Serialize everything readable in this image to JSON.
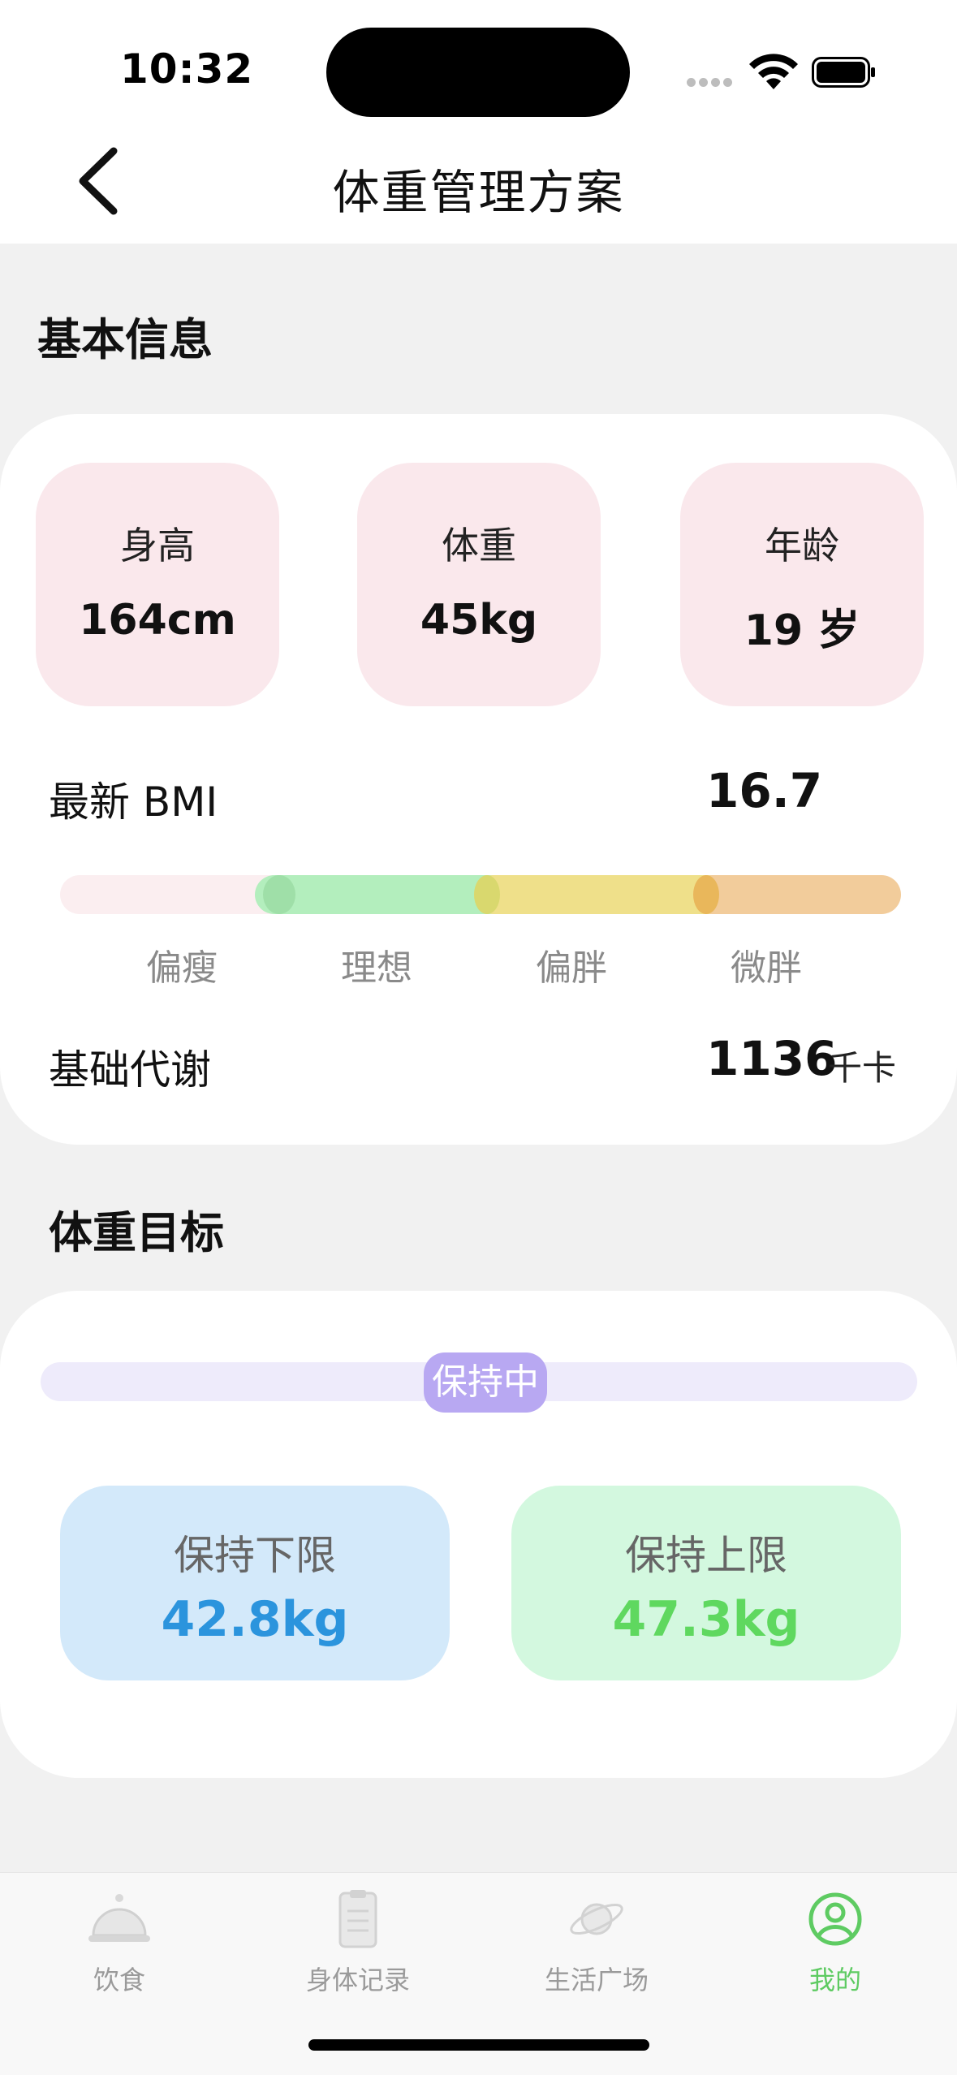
{
  "status_bar": {
    "time": "10:32"
  },
  "header": {
    "title": "体重管理方案",
    "back_icon": "chevron-left-icon"
  },
  "basic_info": {
    "section_title": "基本信息",
    "stats": [
      {
        "label": "身高",
        "value": "164cm"
      },
      {
        "label": "体重",
        "value": "45kg"
      },
      {
        "label": "年龄",
        "value": "19 岁"
      }
    ],
    "bmi": {
      "label": "最新 BMI",
      "value": "16.7",
      "categories": [
        "偏瘦",
        "理想",
        "偏胖",
        "微胖"
      ],
      "colors": [
        "#fbeef0",
        "#b3eebd",
        "#efe08a",
        "#f2cc9b"
      ]
    },
    "bmr": {
      "label": "基础代谢",
      "value": "1136",
      "unit": "千卡"
    }
  },
  "weight_goal": {
    "section_title": "体重目标",
    "status": "保持中",
    "lower": {
      "label": "保持下限",
      "value": "42.8kg",
      "color": "#2b94dd",
      "bg": "#d3e9fa"
    },
    "upper": {
      "label": "保持上限",
      "value": "47.3kg",
      "color": "#5fd85f",
      "bg": "#d3f8df"
    }
  },
  "tab_bar": {
    "items": [
      {
        "label": "饮食",
        "icon": "cloche-icon",
        "active": false
      },
      {
        "label": "身体记录",
        "icon": "clipboard-icon",
        "active": false
      },
      {
        "label": "生活广场",
        "icon": "planet-icon",
        "active": false
      },
      {
        "label": "我的",
        "icon": "user-icon",
        "active": true
      }
    ],
    "active_color": "#5ecb62"
  }
}
